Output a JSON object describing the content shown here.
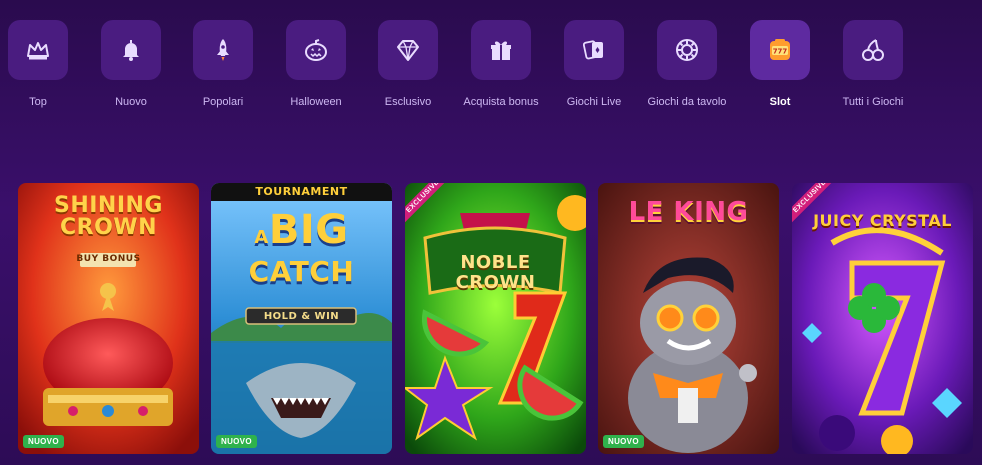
{
  "categories": [
    {
      "label": "Top",
      "icon": "crown-icon"
    },
    {
      "label": "Nuovo",
      "icon": "bell-icon"
    },
    {
      "label": "Popolari",
      "icon": "rocket-icon"
    },
    {
      "label": "Halloween",
      "icon": "pumpkin-icon"
    },
    {
      "label": "Esclusivo",
      "icon": "diamond-icon"
    },
    {
      "label": "Acquista bonus",
      "icon": "gift-icon"
    },
    {
      "label": "Giochi Live",
      "icon": "cards-icon"
    },
    {
      "label": "Giochi da tavolo",
      "icon": "chip-icon"
    },
    {
      "label": "Slot",
      "icon": "slot-777-icon"
    },
    {
      "label": "Tutti i Giochi",
      "icon": "cherries-icon"
    }
  ],
  "active_category": "Slot",
  "games": [
    {
      "title_line1": "SHINING",
      "title_line2": "CROWN",
      "subtitle": "BUY BONUS",
      "badge": "NUOVO",
      "ribbon": ""
    },
    {
      "title_line1": "BIG",
      "title_line2": "CATCH",
      "subtitle": "HOLD & WIN",
      "header": "TOURNAMENT",
      "prefix": "A",
      "badge": "NUOVO",
      "ribbon": ""
    },
    {
      "title_line1": "NOBLE",
      "title_line2": "CROWN",
      "subtitle": "",
      "badge": "",
      "ribbon": "EXCLUSIVE"
    },
    {
      "title_line1": "LE KING",
      "title_line2": "",
      "subtitle": "",
      "badge": "NUOVO",
      "ribbon": ""
    },
    {
      "title_line1": "JUICY",
      "title_line2": "CRYSTAL",
      "subtitle": "",
      "badge": "",
      "ribbon": "EXCLUSIVE"
    }
  ],
  "colors": {
    "accent_active": "#5e2aa0",
    "tile": "#4a1c80",
    "new_badge": "#2fb24c",
    "exclusive_ribbon": "#d21e7b"
  }
}
